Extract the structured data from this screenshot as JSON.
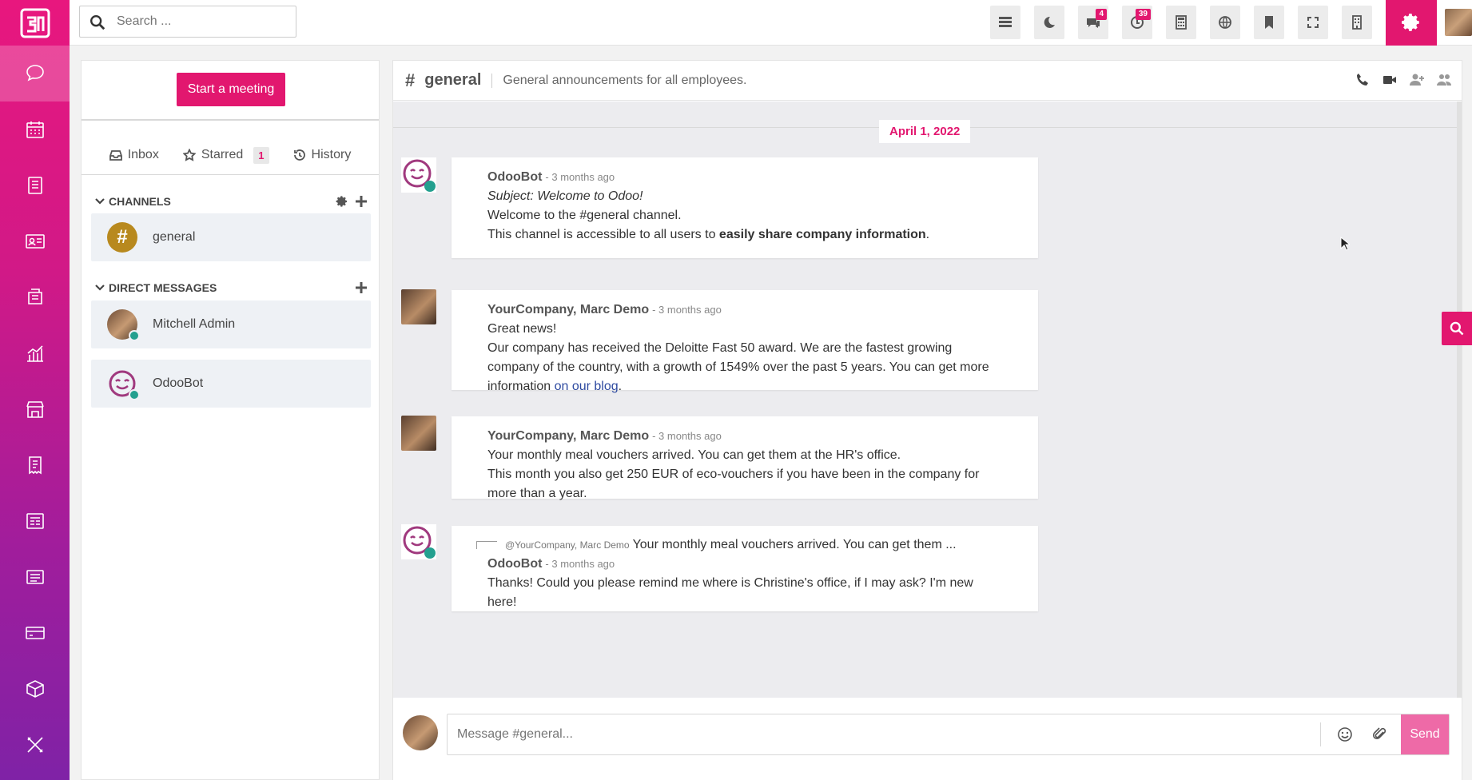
{
  "topbar": {
    "search_placeholder": "Search ...",
    "badges": {
      "chat": "4",
      "activity": "39"
    }
  },
  "rail": {
    "items": [
      "discuss-icon",
      "calendar-icon",
      "notes-icon",
      "contacts-icon",
      "crm-icon",
      "sales-icon",
      "point-of-sale-icon",
      "invoicing-icon",
      "website-icon",
      "inventory-icon",
      "payments-icon",
      "apps-icon",
      "settings-tools-icon"
    ]
  },
  "leftpanel": {
    "meeting_label": "Start a meeting",
    "mailboxes": {
      "inbox": "Inbox",
      "starred": "Starred",
      "starred_count": "1",
      "history": "History"
    },
    "channels_header": "CHANNELS",
    "channels": [
      {
        "name": "general",
        "icon": "#"
      }
    ],
    "dm_header": "DIRECT MESSAGES",
    "direct_messages": [
      {
        "name": "Mitchell Admin"
      },
      {
        "name": "OdooBot"
      }
    ]
  },
  "thread": {
    "hash": "#",
    "name": "general",
    "description": "General announcements for all employees.",
    "date_separator": "April 1, 2022",
    "messages": [
      {
        "author": "OdooBot",
        "date": "- 3 months ago",
        "subject": "Subject: Welcome to Odoo!",
        "line1": "Welcome to the #general channel.",
        "line2_pre": "This channel is accessible to all users to ",
        "line2_bold": "easily share company information",
        "line2_post": "."
      },
      {
        "author": "YourCompany, Marc Demo",
        "date": "- 3 months ago",
        "line1": "Great news!",
        "line2": "Our company has received the Deloitte Fast 50 award. We are the fastest growing company of the country, with a growth of 1549% over the past 5 years. You can get more information ",
        "link": "on our blog",
        "line2_post": "."
      },
      {
        "author": "YourCompany, Marc Demo",
        "date": "- 3 months ago",
        "line1": "Your monthly meal vouchers arrived. You can get them at the HR's office.",
        "line2": "This month you also get 250 EUR of eco-vouchers if you have been in the company for more than a year."
      },
      {
        "reply_author": "@YourCompany, Marc Demo",
        "reply_text": "Your monthly meal vouchers arrived. You can get them ...",
        "author": "OdooBot",
        "date": "- 3 months ago",
        "line1": "Thanks! Could you please remind me where is Christine's office, if I may ask? I'm new here!"
      }
    ]
  },
  "composer": {
    "placeholder": "Message #general...",
    "send_label": "Send"
  },
  "colors": {
    "brand": "#e2176f",
    "online": "#23a08f",
    "general_channel": "#b8891e"
  }
}
